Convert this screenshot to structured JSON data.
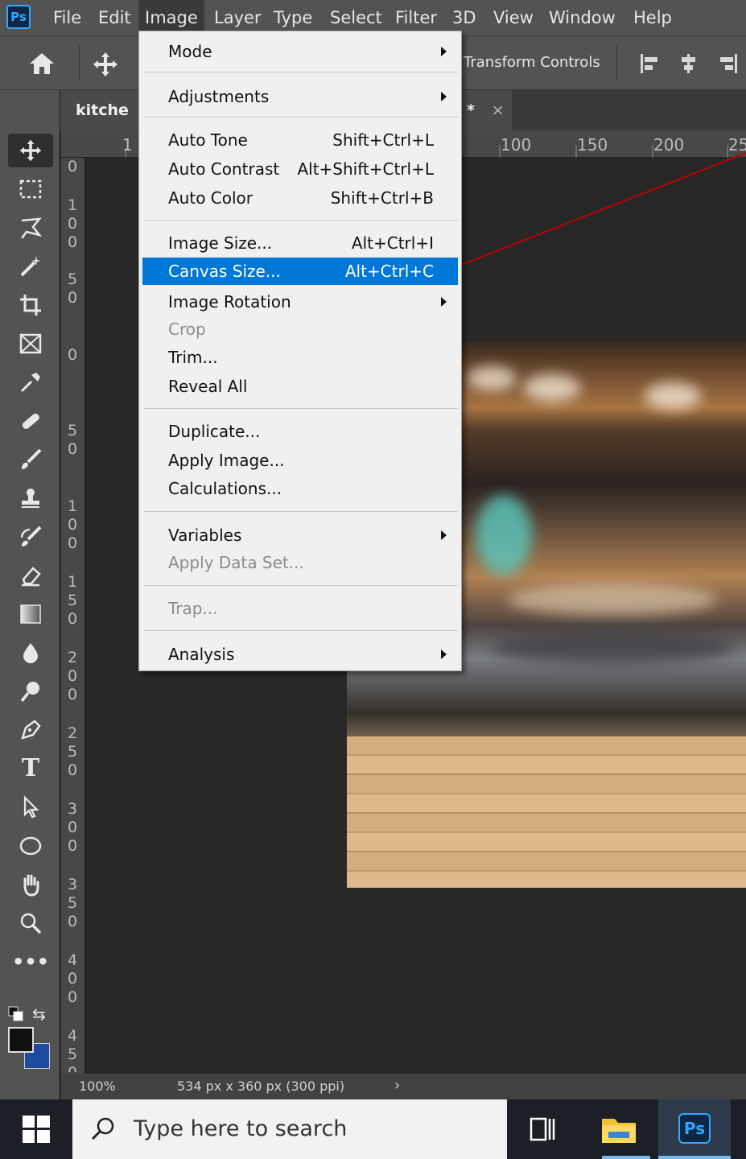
{
  "menubar": {
    "app_logo": "Ps",
    "items": [
      {
        "label": "File"
      },
      {
        "label": "Edit"
      },
      {
        "label": "Image"
      },
      {
        "label": "Layer"
      },
      {
        "label": "Type"
      },
      {
        "label": "Select"
      },
      {
        "label": "Filter"
      },
      {
        "label": "3D"
      },
      {
        "label": "View"
      },
      {
        "label": "Window"
      },
      {
        "label": "Help"
      }
    ]
  },
  "options_bar": {
    "transform_controls_label": "Transform Controls"
  },
  "document": {
    "tab_title": "kitche b",
    "tab2_modified": "*",
    "tab2_close": "×",
    "zoom": "100%",
    "doc_info": "534 px x 360 px (300 ppi)"
  },
  "rulers": {
    "top_labels": [
      "1",
      "100",
      "150",
      "200",
      "25"
    ],
    "left_labels": [
      "0",
      "100",
      "50",
      "0",
      "50",
      "100",
      "150",
      "200",
      "250",
      "300",
      "350",
      "400",
      "450"
    ]
  },
  "image_menu": {
    "items": [
      {
        "label": "Mode",
        "submenu": true
      },
      {
        "label": "Adjustments",
        "submenu": true
      },
      {
        "label": "Auto Tone",
        "shortcut": "Shift+Ctrl+L"
      },
      {
        "label": "Auto Contrast",
        "shortcut": "Alt+Shift+Ctrl+L"
      },
      {
        "label": "Auto Color",
        "shortcut": "Shift+Ctrl+B"
      },
      {
        "label": "Image Size...",
        "shortcut": "Alt+Ctrl+I"
      },
      {
        "label": "Canvas Size...",
        "shortcut": "Alt+Ctrl+C",
        "highlighted": true
      },
      {
        "label": "Image Rotation",
        "submenu": true
      },
      {
        "label": "Crop",
        "disabled": true
      },
      {
        "label": "Trim..."
      },
      {
        "label": "Reveal All"
      },
      {
        "label": "Duplicate..."
      },
      {
        "label": "Apply Image..."
      },
      {
        "label": "Calculations..."
      },
      {
        "label": "Variables",
        "submenu": true
      },
      {
        "label": "Apply Data Set...",
        "disabled": true
      },
      {
        "label": "Trap...",
        "disabled": true
      },
      {
        "label": "Analysis",
        "submenu": true
      }
    ]
  },
  "taskbar": {
    "search_placeholder": "Type here to search",
    "ps_icon_label": "Ps"
  },
  "colors": {
    "highlight": "#0078d7",
    "panel": "#535353",
    "canvas_bg": "#282828",
    "annotation_line": "#c00000"
  }
}
